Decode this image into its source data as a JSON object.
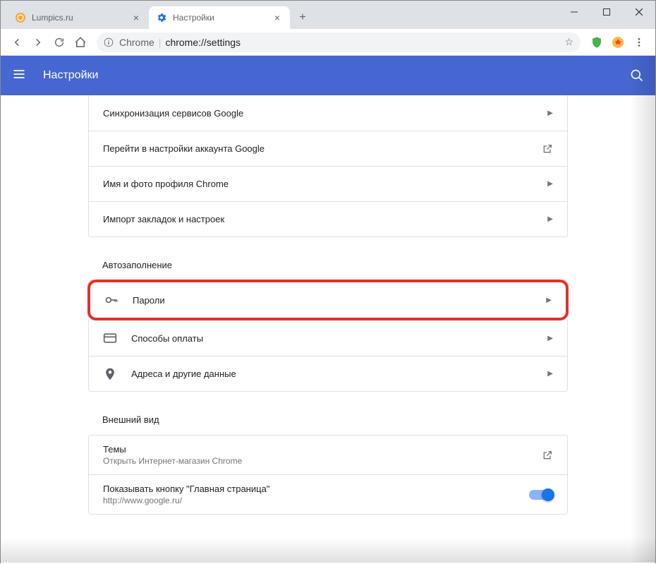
{
  "tabs": [
    {
      "title": "Lumpics.ru"
    },
    {
      "title": "Настройки"
    }
  ],
  "addressbar": {
    "prefix": "Chrome",
    "url": "chrome://settings"
  },
  "header": {
    "title": "Настройки"
  },
  "section1": {
    "rows": [
      {
        "label": "Синхронизация сервисов Google"
      },
      {
        "label": "Перейти в настройки аккаунта Google"
      },
      {
        "label": "Имя и фото профиля Chrome"
      },
      {
        "label": "Импорт закладок и настроек"
      }
    ]
  },
  "autofill": {
    "title": "Автозаполнение",
    "rows": [
      {
        "label": "Пароли"
      },
      {
        "label": "Способы оплаты"
      },
      {
        "label": "Адреса и другие данные"
      }
    ]
  },
  "appearance": {
    "title": "Внешний вид",
    "themes": {
      "title": "Темы",
      "sub": "Открыть Интернет-магазин Chrome"
    },
    "homebutton": {
      "title": "Показывать кнопку \"Главная страница\"",
      "sub": "http://www.google.ru/"
    }
  }
}
